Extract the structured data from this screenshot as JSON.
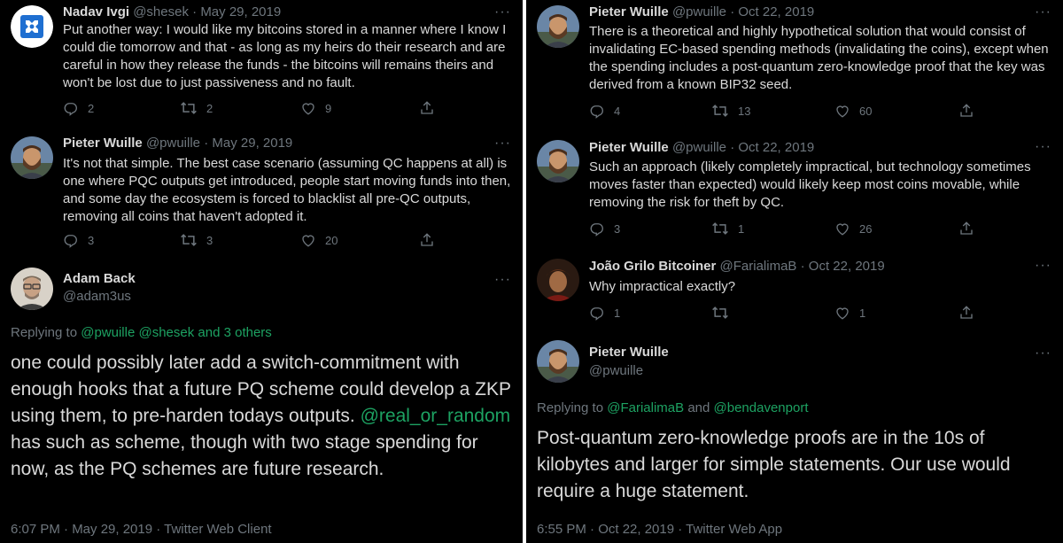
{
  "left": {
    "tweets": [
      {
        "name": "Nadav Ivgi",
        "handle": "@shesek",
        "sep": "·",
        "date": "May 29, 2019",
        "text": "Put another way: I would like my bitcoins stored in a manner where I know I could die tomorrow and that - as long as my heirs do their research and are careful in how they release the funds - the bitcoins will remains theirs and won't be lost due to just passiveness and no fault.",
        "replies": "2",
        "retweets": "2",
        "likes": "9"
      },
      {
        "name": "Pieter Wuille",
        "handle": "@pwuille",
        "sep": "·",
        "date": "May 29, 2019",
        "text": "It's not that simple. The best case scenario (assuming QC happens at all) is one where PQC outputs get introduced, people start moving funds into then, and some day the ecosystem is forced to blacklist all pre-QC outputs, removing all coins that haven't adopted it.",
        "replies": "3",
        "retweets": "3",
        "likes": "20"
      }
    ],
    "focus": {
      "name": "Adam Back",
      "handle": "@adam3us",
      "replying_prefix": "Replying to",
      "replying_to": "@pwuille @shesek and 3 others",
      "mention": "@real_or_random",
      "text_before": "one could possibly later add a switch-commitment with enough hooks that a future PQ scheme could develop a ZKP using them, to pre-harden todays outputs.",
      "text_after": "has such as scheme, though with two stage spending for now, as the PQ schemes are future research.",
      "meta": "6:07 PM · May 29, 2019 · Twitter Web Client"
    }
  },
  "right": {
    "tweets": [
      {
        "name": "Pieter Wuille",
        "handle": "@pwuille",
        "sep": "·",
        "date": "Oct 22, 2019",
        "text": "There is a theoretical and highly hypothetical solution that would consist of invalidating EC-based spending methods (invalidating the coins), except when the spending includes a post-quantum zero-knowledge proof that the key was derived from a known BIP32 seed.",
        "replies": "4",
        "retweets": "13",
        "likes": "60"
      },
      {
        "name": "Pieter Wuille",
        "handle": "@pwuille",
        "sep": "·",
        "date": "Oct 22, 2019",
        "text": "Such an approach (likely completely impractical, but technology sometimes moves faster than expected) would likely keep most coins movable, while removing the risk for theft by QC.",
        "replies": "3",
        "retweets": "1",
        "likes": "26"
      },
      {
        "name": "João Grilo Bitcoiner",
        "handle": "@FarialimaB",
        "sep": "·",
        "date": "Oct 22, 2019",
        "text": "Why impractical exactly?",
        "replies": "1",
        "retweets": "",
        "likes": "1"
      }
    ],
    "focus": {
      "name": "Pieter Wuille",
      "handle": "@pwuille",
      "replying_prefix": "Replying to",
      "replying_to_1": "@FarialimaB",
      "replying_and": "and",
      "replying_to_2": "@bendavenport",
      "text": "Post-quantum zero-knowledge proofs are in the 10s of kilobytes and larger for simple statements. Our use would require a huge statement.",
      "meta": "6:55 PM · Oct 22, 2019 · Twitter Web App"
    }
  },
  "more_label": "···",
  "icons": [
    "reply-icon",
    "retweet-icon",
    "like-icon",
    "share-icon",
    "more-icon"
  ],
  "colors": {
    "background": "#000000",
    "text": "#d9d9d9",
    "muted": "#6e767d",
    "link": "#1da262"
  }
}
